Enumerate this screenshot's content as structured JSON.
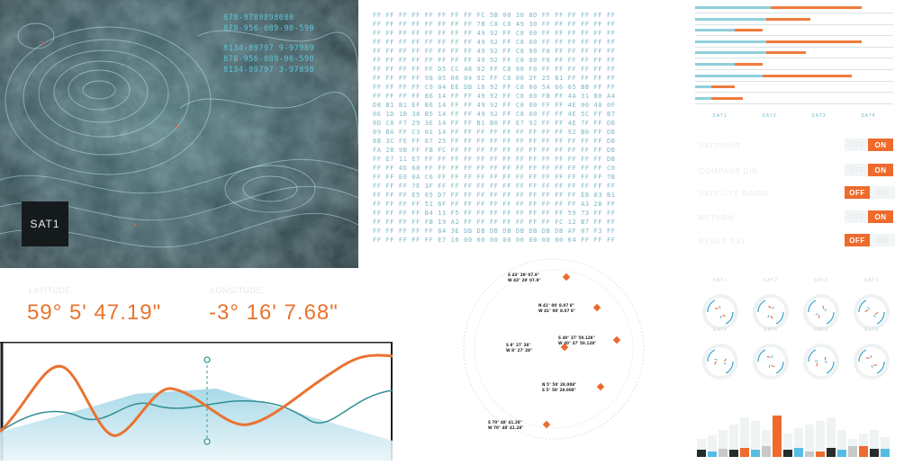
{
  "satellite": {
    "label": "SAT1",
    "coords": [
      "878-9789898080",
      "878-956-089-90-590",
      "",
      "8134-89797 9-97989",
      "878-956-089-90-590",
      "8134-89797 3-97898"
    ]
  },
  "hex_dump": [
    "FF FF FF FF FF FF FF FF FC 5B 00 30 8D FF FF FF FF FF FF",
    "FF FF FF FF FF FF FF FF 7B C8 C0 49 30 FF FF FF FF FF FF",
    "FF FF FF FF FF FF FF FF 49 92 FF C8 00 FF FF FF FF FF FF",
    "FF FF FF FF FF FF FF FF 49 92 FF C8 00 FF FF FF FF FF FF",
    "FF FF FF FF FF FF FF FF 49 92 FF C8 00 F8 FF FF FF FF FF",
    "FF FF FF FF FF FF FF FF 49 92 FF C8 00 F8 FF FF FF FF FF",
    "FF FF FF FF FF D5 CC 48 92 FF C8 00 F0 FF FF FF FF FF FF",
    "FF FF FF FF 98 05 06 04 92 FF C8 00 2F 25 B1 FF FF FF FF",
    "FF FF FF FF C9 04 EE DB 18 92 FF C8 00 5A 66 05 BB FF FF",
    "FF FF FF FF B6 14 FF FF 49 92 FF C8 00 FB FF 4A 31 80 A4",
    "D8 B1 B1 EF B6 14 FF FF 49 92 FF C8 00 FF FF 4E 00 40 0F",
    "0E 1D 1B 38 B5 14 FF FF 49 92 FF C8 00 FF FF 4E 5C FF B7",
    "0D C8 F7 29 3E 14 FF FF B1 B0 FF E7 92 FF FF 4E 7F FF DB",
    "09 BA FF C3 01 14 FF FF FF FF FF FF FF FF FF 92 B0 FF DB",
    "8B 3C FE FF 67 25 FF FF FF FF FF FF FF FF FF FF FF FF DB",
    "FA 2B 9B FF FB FC FF FF FF FF FF FF FF FF FF FF FF FF DB",
    "FF E7 11 E7 FF FF FF FF FF FF FF FF FF FF FF FF FF FF DB",
    "FF FF 4D 60 FF FF FF FF FF FF FF FF FF FF FF FF FF FF C0",
    "FF FF E0 0A C6 FF FF FF FF FF FF FF FF FF FF FF FF FF 7B",
    "FF FF FF 7E 3F FF FF FF FF FF FF FF FF FF FF FF FF FF FF",
    "FF FF FF E5 05 D7 FF FF FF FF FF FF FF FF FF FF EB 03 B1",
    "FF FF FF FF 51 6F FF FF FF FF FF FF FF FF FF FF A3 2B FF",
    "FF FF FF FF B4 11 F5 FF FF FF FF FF FF FF FF 59 73 FF FF",
    "FF FF FF FF FB 19 A2 FF FF FF FF FF FF FF FC 12 B7 FF FF",
    "FF FF FF FF FF 84 3E DB DB DB DB DB DB DB DB AF 07 F3 FF",
    "FF FF FF FF FF E7 16 00 00 00 00 00 00 00 00 64 FF FF FF"
  ],
  "bar_panel": {
    "axis_labels": [
      "SAT1",
      "SAT3",
      "SAT3",
      "SAT4"
    ],
    "rows": [
      {
        "blue": 0.38,
        "orange": 0.84
      },
      {
        "blue": 0.36,
        "orange": 0.58
      },
      {
        "blue": 0.2,
        "orange": 0.34
      },
      {
        "blue": 0.36,
        "orange": 0.84
      },
      {
        "blue": 0.36,
        "orange": 0.56
      },
      {
        "blue": 0.2,
        "orange": 0.34
      },
      {
        "blue": 0.34,
        "orange": 0.79
      },
      {
        "blue": 0.08,
        "orange": 0.2
      },
      {
        "blue": 0.08,
        "orange": 0.24
      }
    ]
  },
  "toggles": [
    {
      "label": "SATPOINT",
      "on": "ON",
      "off": "OFF",
      "state": "on"
    },
    {
      "label": "COMPASS DIR",
      "on": "ON",
      "off": "OFF",
      "state": "on"
    },
    {
      "label": "SATELITE RAIDS",
      "on": "ON",
      "off": "OFF",
      "state": "off"
    },
    {
      "label": "RETURN",
      "on": "ON",
      "off": "OFF",
      "state": "on"
    },
    {
      "label": "RESET SAT",
      "on": "ON",
      "off": "OFF",
      "state": "off"
    }
  ],
  "latitude": {
    "label": "LATITUDE:",
    "value": "59°  5'  47.19\""
  },
  "longitude": {
    "label": "LONGITUDE:",
    "value": "-3°  16'  7.68\""
  },
  "radar_targets": [
    {
      "line1": "S 43° 29' 07.9\"",
      "line2": "W 43° 29' 07.9\""
    },
    {
      "line1": "N 41° 00' 8.07 8\"",
      "line2": "W 41° 00' 8.07 8\""
    },
    {
      "line1": "S 40° 37' 50.128\"",
      "line2": "W 40° 37' 50.128\""
    },
    {
      "line1": "S 8° 27' 28\"",
      "line2": "W 8° 27' 28\""
    },
    {
      "line1": "N 5° 50' 28.008\"",
      "line2": "S 5° 50' 28.008\""
    },
    {
      "line1": "S 70° 48' 41.28\"",
      "line2": "W 70° 48' 41.28\""
    }
  ],
  "gauges": {
    "labels_top": [
      "SAT1",
      "SAT2",
      "SAT3",
      "SAT4"
    ],
    "labels_bottom": [
      "SAT5",
      "SAT6"
    ]
  },
  "colors": {
    "accent": "#ee6b2d",
    "teal": "#8fcfdc",
    "dark": "#1b1f21"
  }
}
